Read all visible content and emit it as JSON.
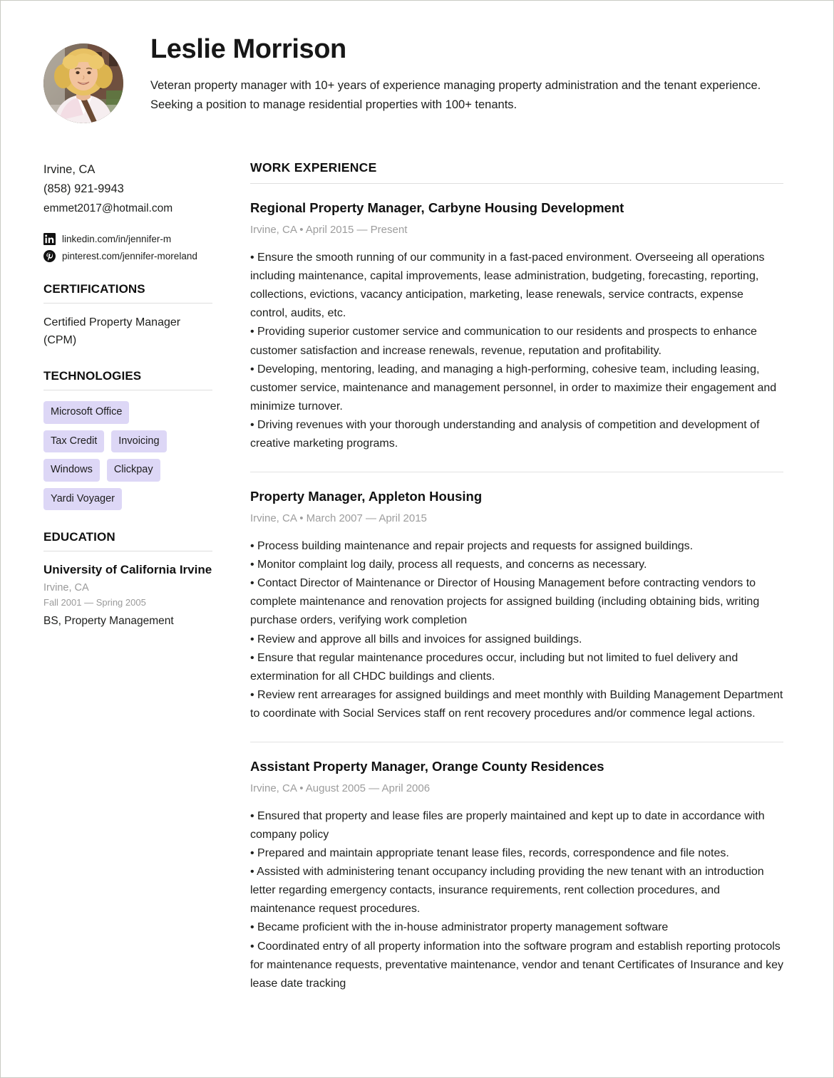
{
  "profile": {
    "name": "Leslie Morrison",
    "summary": "Veteran property manager with 10+ years of experience managing property administration and the tenant experience. Seeking a position to manage residential properties with 100+ tenants.",
    "photo_alt": "profile-photo"
  },
  "contact": {
    "location": "Irvine, CA",
    "phone": "(858) 921-9943",
    "email": "emmet2017@hotmail.com",
    "socials": [
      {
        "icon": "linkedin-icon",
        "text": "linkedin.com/in/jennifer-m"
      },
      {
        "icon": "pinterest-icon",
        "text": "pinterest.com/jennifer-moreland"
      }
    ]
  },
  "certifications": {
    "heading": "CERTIFICATIONS",
    "items": [
      "Certified Property Manager (CPM)"
    ]
  },
  "technologies": {
    "heading": "TECHNOLOGIES",
    "items": [
      "Microsoft Office",
      "Tax Credit",
      "Invoicing",
      "Windows",
      "Clickpay",
      "Yardi Voyager"
    ]
  },
  "education": {
    "heading": "EDUCATION",
    "school": "University of California Irvine",
    "location": "Irvine, CA",
    "dates": "Fall 2001 — Spring 2005",
    "degree": "BS, Property Management"
  },
  "work_experience": {
    "heading": "WORK EXPERIENCE",
    "jobs": [
      {
        "title": "Regional Property Manager, Carbyne Housing Development",
        "meta": "Irvine, CA • April 2015 — Present",
        "bullets": [
          "• Ensure the smooth running of our community in a fast-paced environment. Overseeing all operations including maintenance, capital improvements, lease administration, budgeting, forecasting, reporting, collections, evictions, vacancy anticipation, marketing, lease renewals, service contracts, expense control, audits, etc.",
          "• Providing superior customer service and communication to our residents and prospects to enhance customer satisfaction and increase renewals, revenue, reputation and profitability.",
          "• Developing, mentoring, leading, and managing a high-performing, cohesive team, including leasing, customer service, maintenance and management personnel, in order to maximize their engagement and minimize turnover.",
          "• Driving revenues with your thorough understanding and analysis of competition and development of creative marketing programs."
        ]
      },
      {
        "title": "Property Manager, Appleton Housing",
        "meta": "Irvine, CA • March 2007 — April 2015",
        "bullets": [
          "• Process building maintenance and repair projects and requests for assigned buildings.",
          "• Monitor complaint log daily, process all requests, and concerns as necessary.",
          "• Contact Director of Maintenance or Director of Housing Management before contracting vendors to complete maintenance and renovation projects for assigned building (including obtaining bids, writing purchase orders, verifying work completion",
          "• Review and approve all bills and invoices for assigned buildings.",
          "• Ensure that regular maintenance procedures occur, including but not limited to fuel delivery and extermination for all CHDC buildings and clients.",
          "• Review rent arrearages for assigned buildings and meet monthly with Building Management Department to coordinate with Social Services staff on rent recovery procedures and/or commence legal actions."
        ]
      },
      {
        "title": "Assistant Property Manager, Orange County Residences",
        "meta": "Irvine, CA • August 2005 — April 2006",
        "bullets": [
          "• Ensured that property and lease files are properly maintained and kept up to date in accordance with company policy",
          "• Prepared and maintain appropriate tenant lease files, records, correspondence and file notes.",
          "• Assisted with administering tenant occupancy including providing the new tenant with an introduction letter regarding emergency contacts, insurance requirements, rent collection procedures, and maintenance request procedures.",
          "• Became proficient with the in-house administrator property management software",
          "• Coordinated entry of all property information into the software program and establish reporting protocols for maintenance requests, preventative maintenance, vendor and tenant Certificates of Insurance and key lease date tracking"
        ]
      }
    ]
  },
  "theme": {
    "tag_bg": "#ddd7f6",
    "rule": "#dedede",
    "muted": "#9d9d9d",
    "text": "#20211f",
    "page_border": "#c9cbc4"
  }
}
